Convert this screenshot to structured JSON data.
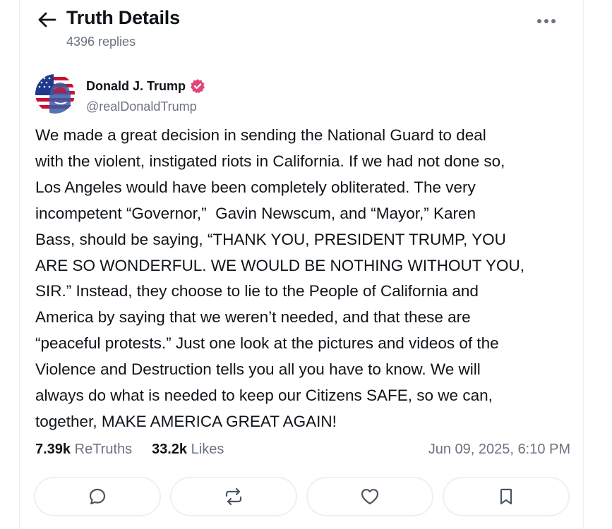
{
  "header": {
    "title": "Truth Details",
    "replies_count": "4396 replies",
    "back_icon": "arrow-left-icon",
    "more_icon": "more-horizontal-icon"
  },
  "post": {
    "author": {
      "name": "Donald J. Trump",
      "handle": "@realDonaldTrump",
      "verified": true,
      "verified_color": "#e0457b",
      "avatar_icon": "profile-avatar"
    },
    "text": "We made a great decision in sending the National Guard to deal\nwith the violent, instigated riots in California. If we had not done so,\nLos Angeles would have been completely obliterated. The very\nincompetent “Governor,”  Gavin Newscum, and “Mayor,” Karen\nBass, should be saying, “THANK YOU, PRESIDENT TRUMP, YOU\nARE SO WONDERFUL. WE WOULD BE NOTHING WITHOUT YOU,\nSIR.” Instead, they choose to lie to the People of California and\nAmerica by saying that we weren’t needed, and that these are\n“peaceful protests.” Just one look at the pictures and videos of the\nViolence and Destruction tells you all you have to know. We will\nalways do what is needed to keep our Citizens SAFE, so we can,\ntogether, MAKE AMERICA GREAT AGAIN!",
    "stats": {
      "retruths_count": "7.39k",
      "retruths_label": "ReTruths",
      "likes_count": "33.2k",
      "likes_label": "Likes",
      "timestamp": "Jun 09, 2025, 6:10 PM"
    },
    "actions": [
      {
        "name": "reply",
        "icon": "reply-icon"
      },
      {
        "name": "retruth",
        "icon": "retruth-icon"
      },
      {
        "name": "like",
        "icon": "heart-icon"
      },
      {
        "name": "bookmark",
        "icon": "bookmark-icon"
      }
    ]
  },
  "colors": {
    "text_primary": "#0f1419",
    "text_secondary": "#6b7280",
    "border": "#eef0f3"
  }
}
